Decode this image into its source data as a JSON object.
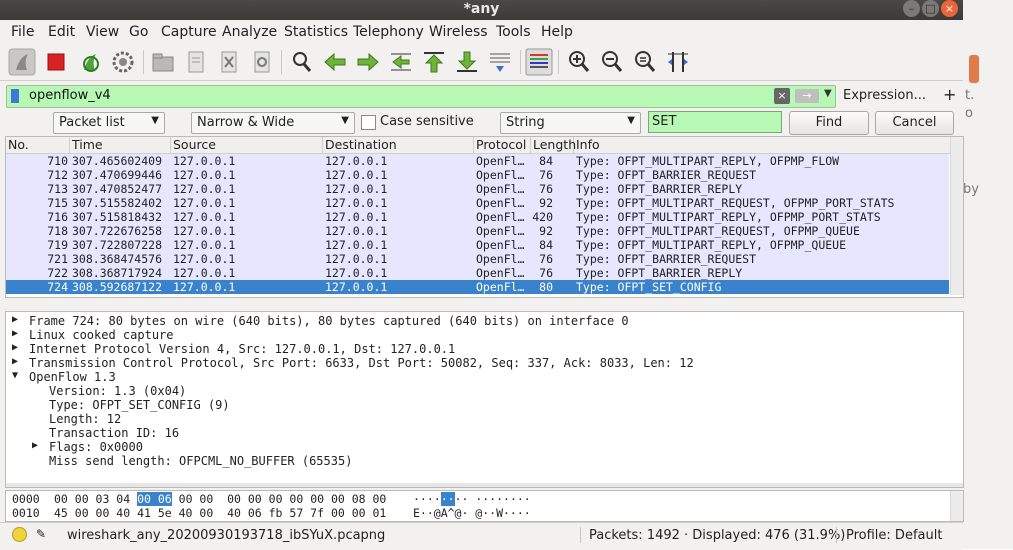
{
  "window": {
    "title": "*any"
  },
  "desktop": {
    "ghost1": "t.",
    "ghost2": "o",
    "ghost3": "by"
  },
  "menu": [
    "File",
    "Edit",
    "View",
    "Go",
    "Capture",
    "Analyze",
    "Statistics",
    "Telephony",
    "Wireless",
    "Tools",
    "Help"
  ],
  "filter": {
    "value": "openflow_v4",
    "expression_label": "Expression...",
    "plus": "+"
  },
  "find": {
    "display_combo": "Packet list",
    "width_combo": "Narrow & Wide",
    "case_label": "Case sensitive",
    "type_combo": "String",
    "search_value": "SET",
    "find_button": "Find",
    "cancel_button": "Cancel"
  },
  "packet_list": {
    "columns": [
      "No.",
      "Time",
      "Source",
      "Destination",
      "Protocol",
      "Length",
      "Info"
    ],
    "rows": [
      {
        "no": "710",
        "time": "307.465602409",
        "src": "127.0.0.1",
        "dst": "127.0.0.1",
        "proto": "OpenFl…",
        "len": "84",
        "info": "Type: OFPT_MULTIPART_REPLY, OFPMP_FLOW"
      },
      {
        "no": "712",
        "time": "307.470699446",
        "src": "127.0.0.1",
        "dst": "127.0.0.1",
        "proto": "OpenFl…",
        "len": "76",
        "info": "Type: OFPT_BARRIER_REQUEST"
      },
      {
        "no": "713",
        "time": "307.470852477",
        "src": "127.0.0.1",
        "dst": "127.0.0.1",
        "proto": "OpenFl…",
        "len": "76",
        "info": "Type: OFPT_BARRIER_REPLY"
      },
      {
        "no": "715",
        "time": "307.515582402",
        "src": "127.0.0.1",
        "dst": "127.0.0.1",
        "proto": "OpenFl…",
        "len": "92",
        "info": "Type: OFPT_MULTIPART_REQUEST, OFPMP_PORT_STATS"
      },
      {
        "no": "716",
        "time": "307.515818432",
        "src": "127.0.0.1",
        "dst": "127.0.0.1",
        "proto": "OpenFl…",
        "len": "420",
        "info": "Type: OFPT_MULTIPART_REPLY, OFPMP_PORT_STATS"
      },
      {
        "no": "718",
        "time": "307.722676258",
        "src": "127.0.0.1",
        "dst": "127.0.0.1",
        "proto": "OpenFl…",
        "len": "92",
        "info": "Type: OFPT_MULTIPART_REQUEST, OFPMP_QUEUE"
      },
      {
        "no": "719",
        "time": "307.722807228",
        "src": "127.0.0.1",
        "dst": "127.0.0.1",
        "proto": "OpenFl…",
        "len": "84",
        "info": "Type: OFPT_MULTIPART_REPLY, OFPMP_QUEUE"
      },
      {
        "no": "721",
        "time": "308.368474576",
        "src": "127.0.0.1",
        "dst": "127.0.0.1",
        "proto": "OpenFl…",
        "len": "76",
        "info": "Type: OFPT_BARRIER_REQUEST"
      },
      {
        "no": "722",
        "time": "308.368717924",
        "src": "127.0.0.1",
        "dst": "127.0.0.1",
        "proto": "OpenFl…",
        "len": "76",
        "info": "Type: OFPT_BARRIER_REPLY"
      },
      {
        "no": "724",
        "time": "308.592687122",
        "src": "127.0.0.1",
        "dst": "127.0.0.1",
        "proto": "OpenFl…",
        "len": "80",
        "info": "Type: OFPT_SET_CONFIG"
      }
    ]
  },
  "details": [
    {
      "toggle": "▶",
      "text": "Frame 724: 80 bytes on wire (640 bits), 80 bytes captured (640 bits) on interface 0"
    },
    {
      "toggle": "▶",
      "text": "Linux cooked capture"
    },
    {
      "toggle": "▶",
      "text": "Internet Protocol Version 4, Src: 127.0.0.1, Dst: 127.0.0.1"
    },
    {
      "toggle": "▶",
      "text": "Transmission Control Protocol, Src Port: 6633, Dst Port: 50082, Seq: 337, Ack: 8033, Len: 12"
    },
    {
      "toggle": "▼",
      "text": "OpenFlow 1.3"
    },
    {
      "toggle": "",
      "text": "Version: 1.3 (0x04)"
    },
    {
      "toggle": "",
      "text": "Type: OFPT_SET_CONFIG (9)"
    },
    {
      "toggle": "",
      "text": "Length: 12"
    },
    {
      "toggle": "",
      "text": "Transaction ID: 16"
    },
    {
      "toggle": "▶",
      "text": "Flags: 0x0000"
    },
    {
      "toggle": "",
      "text": "Miss send length: OFPCML_NO_BUFFER (65535)"
    }
  ],
  "bytes": [
    {
      "offset": "0000",
      "hex_pre": "00 00 03 04 ",
      "hex_hl": "00 06",
      "hex_post": " 00 00  00 00 00 00 00 00 08 00",
      "ascii_pre": "····",
      "ascii_hl": "··",
      "ascii_post": "·· ········"
    },
    {
      "offset": "0010",
      "hex_pre": "45 00 00 40 41 5e 40 00  40 06 fb 57 7f 00 00 01",
      "hex_hl": "",
      "hex_post": "",
      "ascii_pre": "E··@A^@· @··W····",
      "ascii_hl": "",
      "ascii_post": ""
    }
  ],
  "status": {
    "file": "wireshark_any_20200930193718_ibSYuX.pcapng",
    "packets": "Packets: 1492 · Displayed: 476 (31.9%)",
    "profile": "Profile: Default"
  }
}
